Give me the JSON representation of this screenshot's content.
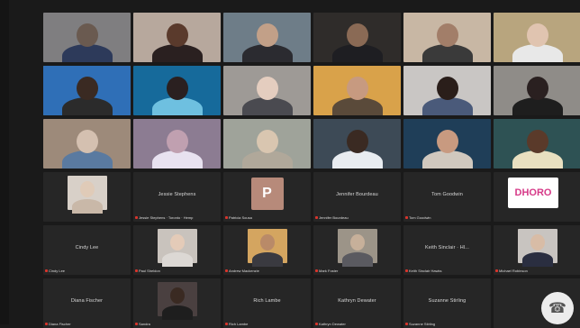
{
  "participants": [
    {
      "type": "video",
      "bg": "#7f7e80",
      "head": "#6a5a50",
      "body": "#2d3a5a",
      "label": ""
    },
    {
      "type": "video",
      "bg": "#b7a89d",
      "head": "#5a3a2c",
      "body": "#2a2020",
      "label": ""
    },
    {
      "type": "video",
      "bg": "#6e7d88",
      "head": "#c2a088",
      "body": "#2b2b30",
      "label": ""
    },
    {
      "type": "video",
      "bg": "#2f2c2a",
      "head": "#8a6a55",
      "body": "#1e1e22",
      "label": ""
    },
    {
      "type": "video",
      "bg": "#c8b7a4",
      "head": "#a27e69",
      "body": "#3a3a3a",
      "label": ""
    },
    {
      "type": "video",
      "bg": "#b8a57e",
      "head": "#e0c4b0",
      "body": "#e8e8e8",
      "label": ""
    },
    {
      "type": "video",
      "bg": "#2f6fb7",
      "head": "#3a2a22",
      "body": "#2b2b2b",
      "label": "",
      "active": true
    },
    {
      "type": "video",
      "bg": "#166a9b",
      "head": "#2a2020",
      "body": "#6ec0e0",
      "label": ""
    },
    {
      "type": "video",
      "bg": "#9e9a96",
      "head": "#e4cdbf",
      "body": "#4a4a50",
      "label": ""
    },
    {
      "type": "video",
      "bg": "#d9a24a",
      "head": "#c79a80",
      "body": "#5a4a3a",
      "label": ""
    },
    {
      "type": "video",
      "bg": "#c9c6c4",
      "head": "#2a1e1a",
      "body": "#4a5a7a",
      "label": ""
    },
    {
      "type": "video",
      "bg": "#8f8c88",
      "head": "#2a2020",
      "body": "#1e1e1e",
      "label": ""
    },
    {
      "type": "video",
      "bg": "#9d8a7a",
      "head": "#d4c0b0",
      "body": "#5a7aa0",
      "label": ""
    },
    {
      "type": "video",
      "bg": "#8c7c92",
      "head": "#c0a0b0",
      "body": "#e8e2f0",
      "label": ""
    },
    {
      "type": "video",
      "bg": "#9fa39a",
      "head": "#d9c6b0",
      "body": "#b0a89a",
      "label": ""
    },
    {
      "type": "video",
      "bg": "#3d4a56",
      "head": "#3a2a22",
      "body": "#e8ecf0",
      "label": ""
    },
    {
      "type": "video",
      "bg": "#1f3e58",
      "head": "#c89a80",
      "body": "#d0c8be",
      "label": ""
    },
    {
      "type": "video",
      "bg": "#2e5254",
      "head": "#5a3a2a",
      "body": "#e8e0c0",
      "label": ""
    },
    {
      "type": "video",
      "bg": "#3b3b3b",
      "head": "#e0cbb8",
      "body": "#c9b8a8",
      "label": "",
      "inset": "#d8d0c8"
    },
    {
      "type": "name",
      "center": "Jessie Stephens",
      "label": "Jessie Stephens · Toronto · Hemp"
    },
    {
      "type": "letter",
      "letter": "P",
      "label": "Patricia Sousa"
    },
    {
      "type": "name",
      "center": "Jennifer Bourdeau",
      "label": "Jennifer Bourdeau"
    },
    {
      "type": "name",
      "center": "Tom Goodwin",
      "label": "Tom Goodwin"
    },
    {
      "type": "logo",
      "logo": "DHORO",
      "label": ""
    },
    {
      "type": "name",
      "center": "Cindy Lee",
      "label": "Cindy Lee"
    },
    {
      "type": "video",
      "bg": "#2e2e2e",
      "head": "#e4cbb8",
      "body": "#dcd8d4",
      "label": "Paul Sheldon",
      "inset": "#c9c3bd"
    },
    {
      "type": "video",
      "bg": "#2e2e2e",
      "head": "#b98a68",
      "body": "#3a3a40",
      "label": "Andrew Mackenzie",
      "inset": "#d4a560"
    },
    {
      "type": "video",
      "bg": "#2e2e2e",
      "head": "#c7b09a",
      "body": "#5a5a60",
      "label": "Mark Foster",
      "inset": "#9c9488"
    },
    {
      "type": "name",
      "center": "Keith Sinclair · Hl...",
      "label": "Keith Sinclair Hawks"
    },
    {
      "type": "video",
      "bg": "#2e2e2e",
      "head": "#d8bca6",
      "body": "#2a2e40",
      "label": "Michael Robinson",
      "inset": "#c8c4c0"
    },
    {
      "type": "name",
      "center": "Diana Fischer",
      "label": "Diana Fischer"
    },
    {
      "type": "video",
      "bg": "#2e2e2e",
      "head": "#3a2a22",
      "body": "#1e1e1e",
      "label": "Sandra",
      "inset": "#4a4040"
    },
    {
      "type": "name",
      "center": "Rich Lambe",
      "label": "Rich Lambe"
    },
    {
      "type": "name",
      "center": "Kathryn Dewater",
      "label": "Kathryn Dewater"
    },
    {
      "type": "name",
      "center": "Suzanne Stirling",
      "label": "Suzanne Stirling"
    },
    {
      "type": "call",
      "label": ""
    }
  ]
}
